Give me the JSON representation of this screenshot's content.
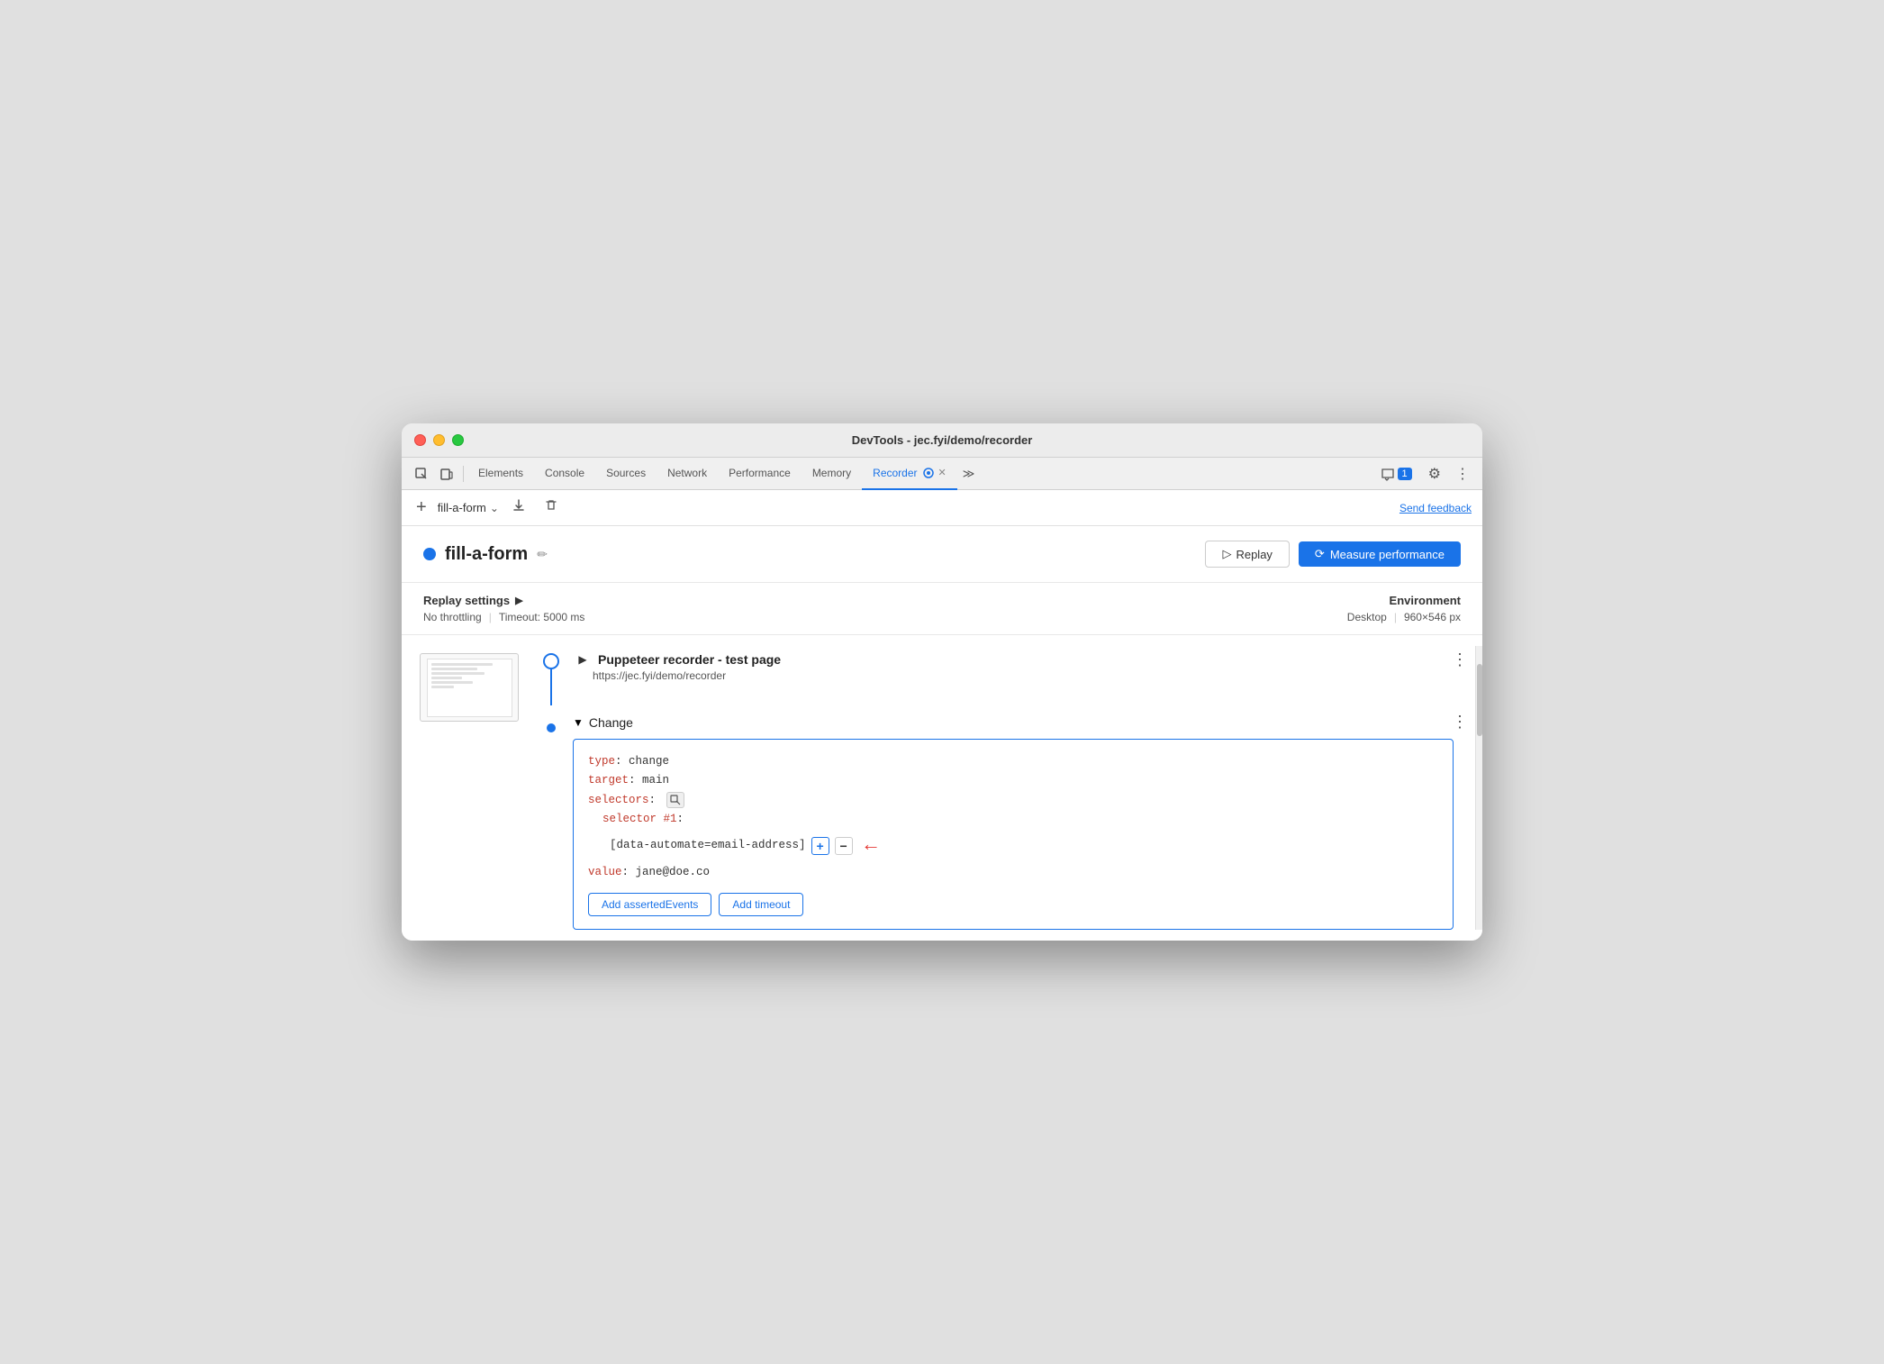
{
  "window": {
    "title": "DevTools - jec.fyi/demo/recorder"
  },
  "traffic_lights": {
    "red": "red-traffic-light",
    "yellow": "yellow-traffic-light",
    "green": "green-traffic-light"
  },
  "tabs": {
    "items": [
      {
        "label": "Elements",
        "active": false
      },
      {
        "label": "Console",
        "active": false
      },
      {
        "label": "Sources",
        "active": false
      },
      {
        "label": "Network",
        "active": false
      },
      {
        "label": "Performance",
        "active": false
      },
      {
        "label": "Memory",
        "active": false
      },
      {
        "label": "Recorder",
        "active": true
      },
      {
        "label": "≫",
        "active": false
      }
    ],
    "recorder_label": "Recorder",
    "more_label": "≫"
  },
  "toolbar": {
    "add_label": "+",
    "recording_name": "fill-a-form",
    "download_icon": "⬇",
    "delete_icon": "🗑",
    "send_feedback": "Send feedback"
  },
  "header": {
    "dot_color": "#1a73e8",
    "title": "fill-a-form",
    "edit_icon": "✏",
    "replay_label": "Replay",
    "measure_label": "Measure performance"
  },
  "settings": {
    "replay_settings_label": "Replay settings",
    "no_throttling": "No throttling",
    "timeout": "Timeout: 5000 ms",
    "environment_label": "Environment",
    "desktop": "Desktop",
    "resolution": "960×546 px"
  },
  "step1": {
    "title": "Puppeteer recorder - test page",
    "url": "https://jec.fyi/demo/recorder"
  },
  "change_step": {
    "title": "Change",
    "type_key": "type",
    "type_val": "change",
    "target_key": "target",
    "target_val": "main",
    "selectors_key": "selectors",
    "selector_num_key": "selector #1",
    "selector_val": "[data-automate=email-address]",
    "value_key": "value",
    "value_val": "jane@doe.co",
    "add_asserted_label": "Add assertedEvents",
    "add_timeout_label": "Add timeout"
  },
  "icons": {
    "play": "▷",
    "measure_circle": "⟳",
    "chevron_right": "▶",
    "chevron_down": "▼",
    "cursor_icon": "⌖",
    "dots_vertical": "⋮",
    "more_tools": "≫",
    "gear": "⚙",
    "kebab": "⋮",
    "message": "💬",
    "arrow_right": "←"
  }
}
